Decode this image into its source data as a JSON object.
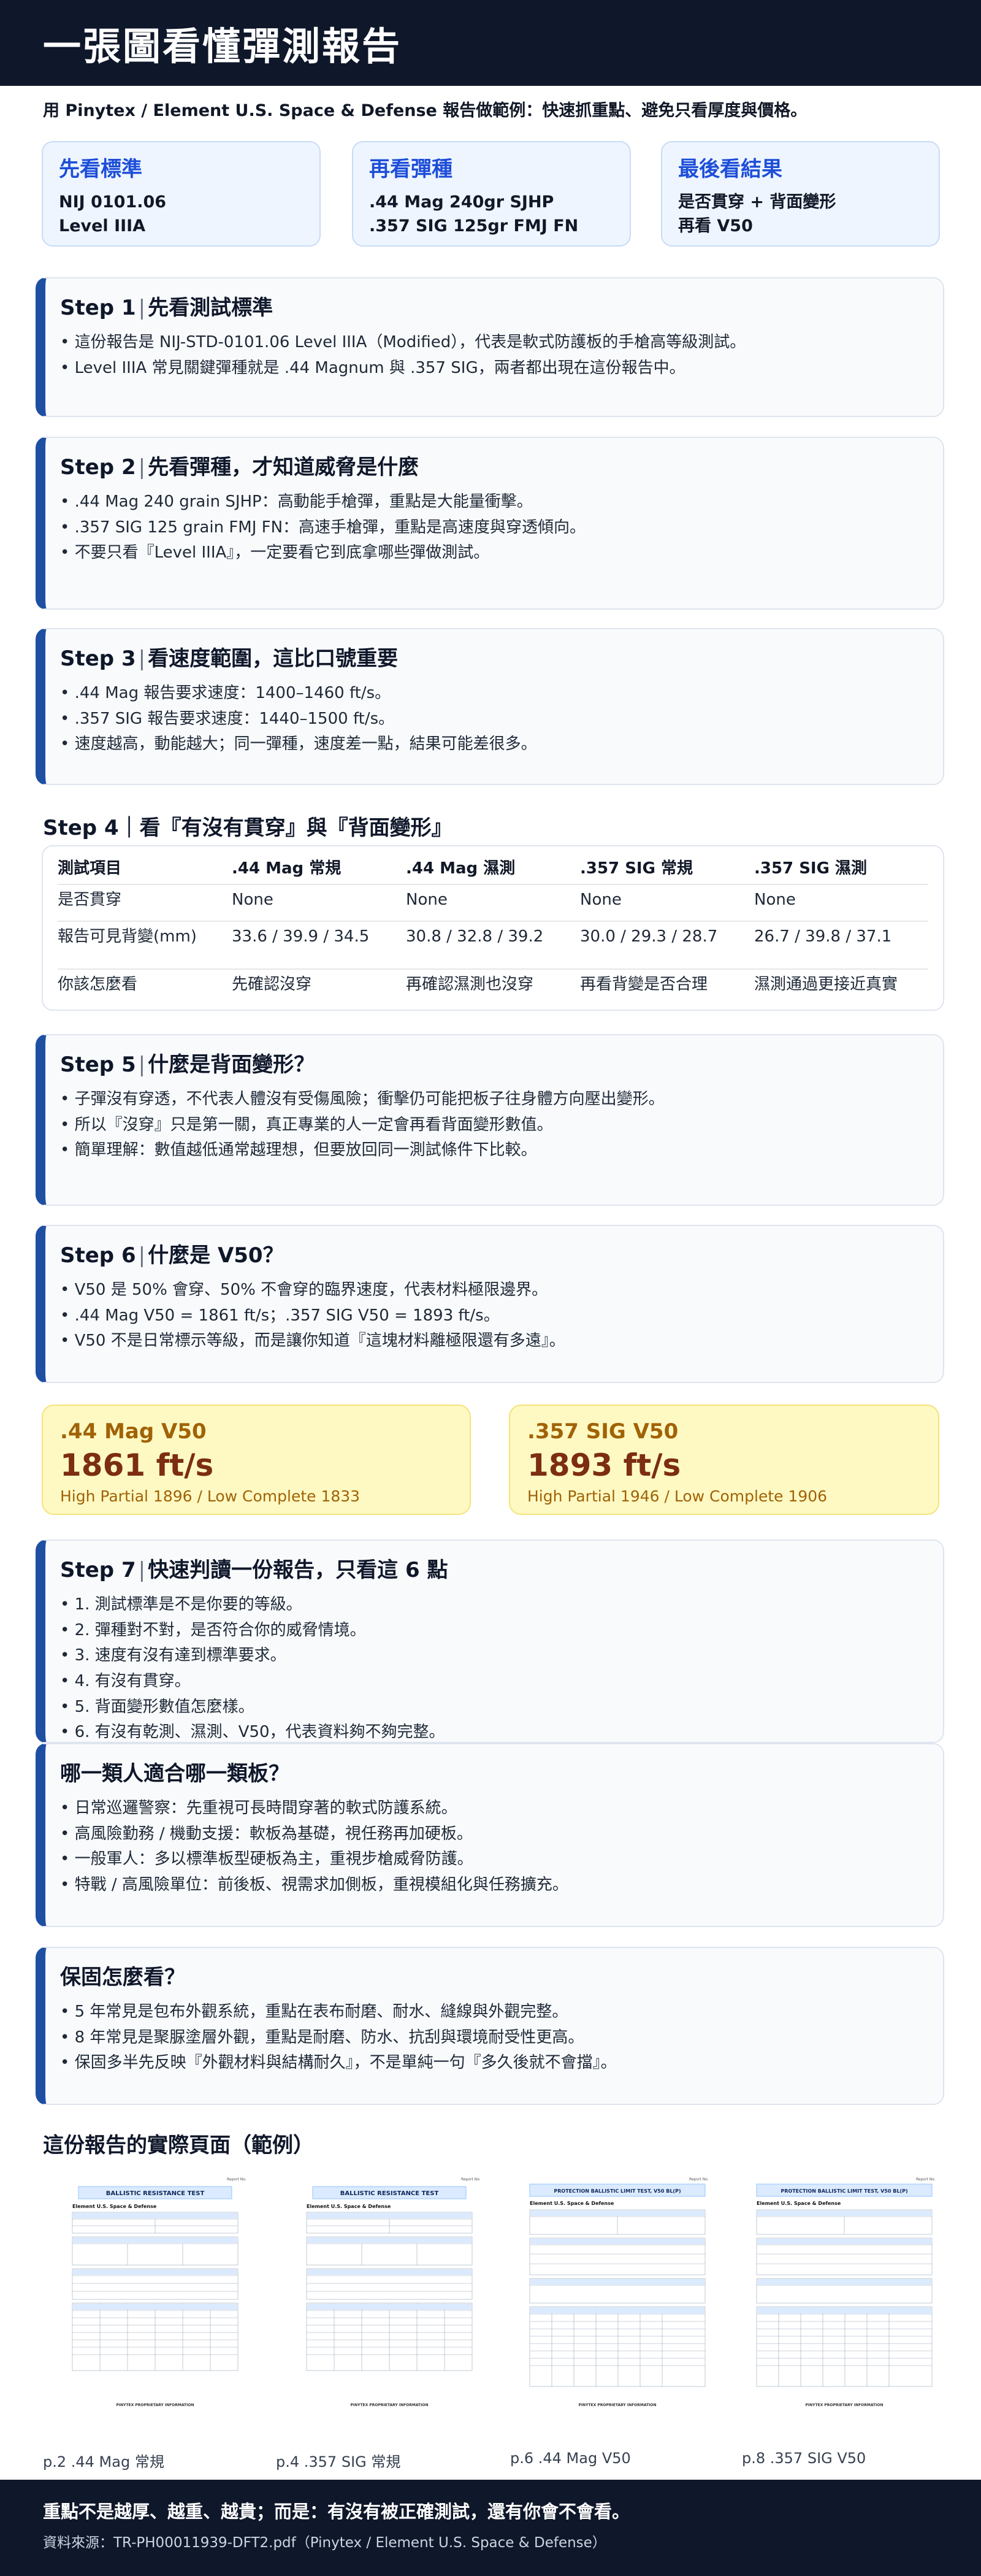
{
  "header": {
    "title": "一張圖看懂彈測報告"
  },
  "subtitle": "用 Pinytex / Element U.S. Space & Defense 報告做範例：快速抓重點、避免只看厚度與價格。",
  "top_cards": [
    {
      "title": "先看標準",
      "lines": [
        "NIJ 0101.06",
        "Level IIIA"
      ]
    },
    {
      "title": "再看彈種",
      "lines": [
        ".44 Mag 240gr SJHP",
        ".357 SIG 125gr FMJ FN"
      ]
    },
    {
      "title": "最後看結果",
      "lines": [
        "是否貫穿 + 背面變形",
        "再看 V50"
      ]
    }
  ],
  "steps": [
    {
      "label": "Step 1",
      "title": "先看測試標準",
      "bullets": [
        "• 這份報告是 NIJ-STD-0101.06 Level IIIA（Modified），代表是軟式防護板的手槍高等級測試。",
        "• Level IIIA 常見關鍵彈種就是 .44 Magnum 與 .357 SIG，兩者都出現在這份報告中。"
      ]
    },
    {
      "label": "Step 2",
      "title": "先看彈種，才知道威脅是什麼",
      "bullets": [
        "• .44 Mag 240 grain SJHP：高動能手槍彈，重點是大能量衝擊。",
        "• .357 SIG 125 grain FMJ FN：高速手槍彈，重點是高速度與穿透傾向。",
        "• 不要只看『Level IIIA』，一定要看它到底拿哪些彈做測試。"
      ]
    },
    {
      "label": "Step 3",
      "title": "看速度範圍，這比口號重要",
      "bullets": [
        "• .44 Mag 報告要求速度：1400–1460 ft/s。",
        "• .357 SIG 報告要求速度：1440–1500 ft/s。",
        "• 速度越高，動能越大；同一彈種，速度差一點，結果可能差很多。"
      ]
    },
    {
      "label": "Step 5",
      "title": "什麼是背面變形？",
      "bullets": [
        "• 子彈沒有穿透，不代表人體沒有受傷風險；衝擊仍可能把板子往身體方向壓出變形。",
        "• 所以『沒穿』只是第一關，真正專業的人一定會再看背面變形數值。",
        "• 簡單理解：數值越低通常越理想，但要放回同一測試條件下比較。"
      ]
    },
    {
      "label": "Step 6",
      "title": "什麼是 V50？",
      "bullets": [
        "• V50 是 50% 會穿、50% 不會穿的臨界速度，代表材料極限邊界。",
        "• .44 Mag V50 = 1861 ft/s；.357 SIG V50 = 1893 ft/s。",
        "• V50 不是日常標示等級，而是讓你知道『這塊材料離極限還有多遠』。"
      ]
    },
    {
      "label": "Step 7",
      "title": "快速判讀一份報告，只看這 6 點",
      "bullets": [
        "• 1. 測試標準是不是你要的等級。",
        "• 2. 彈種對不對，是否符合你的威脅情境。",
        "• 3. 速度有沒有達到標準要求。",
        "• 4. 有沒有貫穿。",
        "• 5. 背面變形數值怎麼樣。",
        "• 6. 有沒有乾測、濕測、V50，代表資料夠不夠完整。"
      ]
    },
    {
      "label": "",
      "title": "哪一類人適合哪一類板？",
      "bullets": [
        "• 日常巡邏警察：先重視可長時間穿著的軟式防護系統。",
        "• 高風險勤務 / 機動支援：軟板為基礎，視任務再加硬板。",
        "• 一般軍人：多以標準板型硬板為主，重視步槍威脅防護。",
        "• 特戰 / 高風險單位：前後板、視需求加側板，重視模組化與任務擴充。"
      ]
    },
    {
      "label": "",
      "title": "保固怎麼看？",
      "bullets": [
        "• 5 年常見是包布外觀系統，重點在表布耐磨、耐水、縫線與外觀完整。",
        "• 8 年常見是聚脲塗層外觀，重點是耐磨、防水、抗刮與環境耐受性更高。",
        "• 保固多半先反映『外觀材料與結構耐久』，不是單純一句『多久後就不會擋』。"
      ]
    }
  ],
  "step4": {
    "title": "Step 4｜看『有沒有貫穿』與『背面變形』",
    "headers": [
      "測試項目",
      ".44 Mag 常規",
      ".44 Mag 濕測",
      ".357 SIG 常規",
      ".357 SIG 濕測"
    ],
    "rows": [
      [
        "是否貫穿",
        "None",
        "None",
        "None",
        "None"
      ],
      [
        "報告可見背變(mm)",
        "33.6 / 39.9 / 34.5",
        "30.8 / 32.8 / 39.2",
        "30.0 / 29.3 / 28.7",
        "26.7 / 39.8 / 37.1"
      ],
      [
        "你該怎麼看",
        "先確認沒穿",
        "再確認濕測也沒穿",
        "再看背變是否合理",
        "濕測通過更接近真實"
      ]
    ]
  },
  "v50_cards": [
    {
      "title": ".44 Mag V50",
      "value": "1861 ft/s",
      "sub": "High Partial 1896 / Low Complete 1833"
    },
    {
      "title": ".357 SIG V50",
      "value": "1893 ft/s",
      "sub": "High Partial 1946 / Low Complete 1906"
    }
  ],
  "pages_section": {
    "title": "這份報告的實際頁面（範例）",
    "thumbs": [
      {
        "heading": "BALLISTIC RESISTANCE TEST",
        "caption": "p.2 .44 Mag 常規"
      },
      {
        "heading": "BALLISTIC RESISTANCE TEST",
        "caption": "p.4 .357 SIG 常規"
      },
      {
        "heading": "PROTECTION BALLISTIC LIMIT TEST, V50 BL(P)",
        "caption": "p.6 .44 Mag V50"
      },
      {
        "heading": "PROTECTION BALLISTIC LIMIT TEST, V50 BL(P)",
        "caption": "p.8 .357 SIG V50"
      }
    ],
    "thumb_company": "Element U.S. Space & Defense",
    "thumb_footer": "PINYTEX PROPRIETARY INFORMATION"
  },
  "footer": {
    "main": "重點不是越厚、越重、越貴；而是：有沒有被正確測試，還有你會不會看。",
    "source": "資料來源：TR-PH00011939-DFT2.pdf（Pinytex / Element U.S. Space & Defense）"
  },
  "colors": {
    "navy": "#0f172a",
    "accent_blue": "#1e4fa3",
    "card_blue": "#eef5ff",
    "card_yellow": "#fef9c3"
  }
}
